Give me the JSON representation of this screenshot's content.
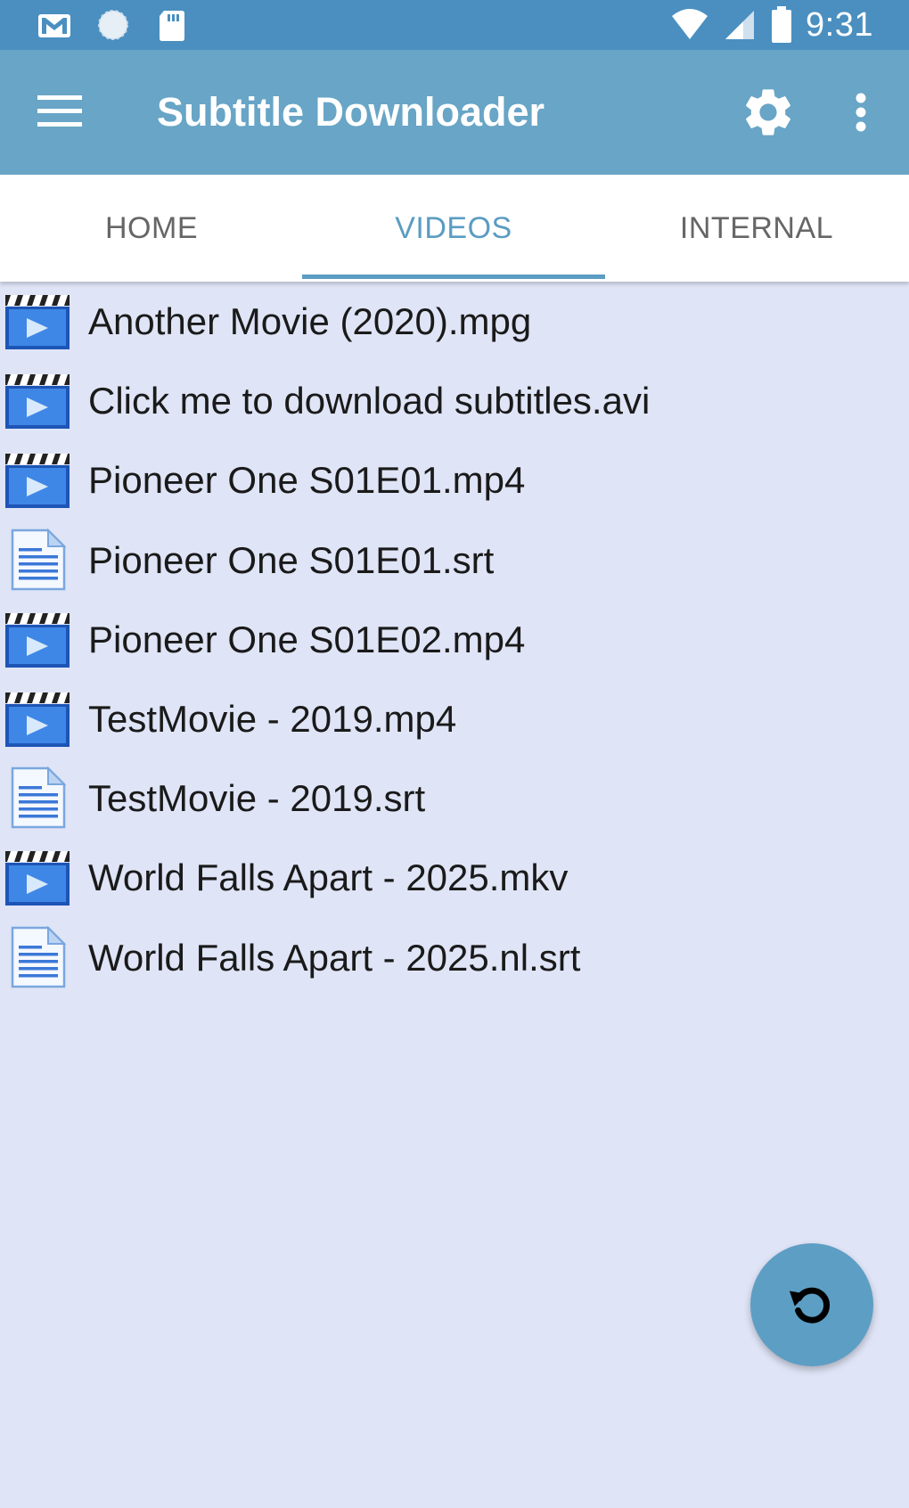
{
  "status_bar": {
    "time": "9:31",
    "left_icons": [
      "gmail-icon",
      "sync-icon",
      "sd-card-icon"
    ],
    "right_icons": [
      "wifi-icon",
      "signal-icon",
      "battery-icon"
    ]
  },
  "app_bar": {
    "title": "Subtitle Downloader",
    "menu_icon": "hamburger-menu-icon",
    "settings_icon": "gear-icon",
    "overflow_icon": "more-vert-icon"
  },
  "tabs": [
    {
      "label": "HOME",
      "active": false
    },
    {
      "label": "VIDEOS",
      "active": true
    },
    {
      "label": "INTERNAL",
      "active": false
    }
  ],
  "files": [
    {
      "name": "Another Movie (2020).mpg",
      "type": "video"
    },
    {
      "name": "Click me to download subtitles.avi",
      "type": "video"
    },
    {
      "name": "Pioneer One S01E01.mp4",
      "type": "video"
    },
    {
      "name": "Pioneer One S01E01.srt",
      "type": "subtitle"
    },
    {
      "name": "Pioneer One S01E02.mp4",
      "type": "video"
    },
    {
      "name": "TestMovie - 2019.mp4",
      "type": "video"
    },
    {
      "name": "TestMovie - 2019.srt",
      "type": "subtitle"
    },
    {
      "name": "World Falls Apart - 2025.mkv",
      "type": "video"
    },
    {
      "name": "World Falls Apart - 2025.nl.srt",
      "type": "subtitle"
    }
  ],
  "fab": {
    "icon": "refresh-icon"
  },
  "colors": {
    "status_bar": "#4a8fc0",
    "app_bar": "#68a5c6",
    "accent": "#5b9cc2",
    "list_background": "#dfe4f6"
  }
}
